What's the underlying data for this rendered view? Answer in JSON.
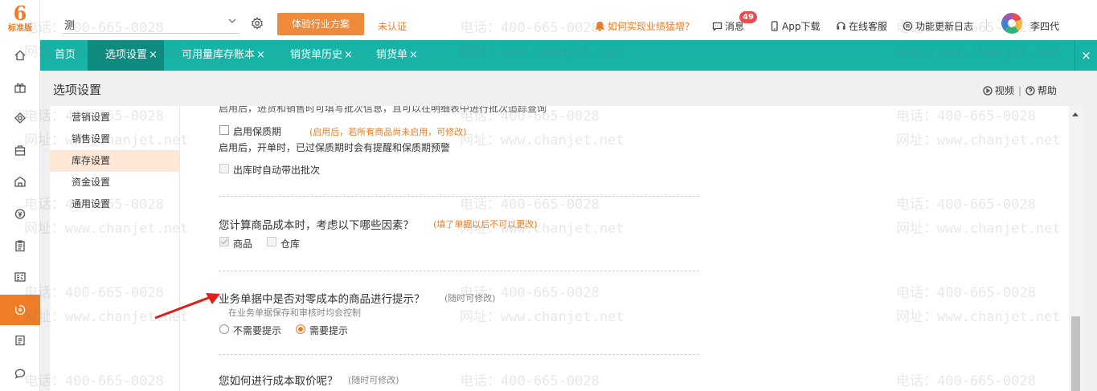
{
  "app": {
    "logo_glyph": "6",
    "logo_edition": "标准版"
  },
  "rail": {
    "items": [
      {
        "icon": "home-icon"
      },
      {
        "icon": "gift-icon"
      },
      {
        "icon": "marketing-icon"
      },
      {
        "icon": "bag-icon"
      },
      {
        "icon": "warehouse-icon"
      },
      {
        "icon": "money-icon"
      },
      {
        "icon": "clipboard-icon"
      },
      {
        "icon": "report-icon"
      },
      {
        "icon": "settings-cycle-icon",
        "active": true
      },
      {
        "icon": "doc-icon"
      },
      {
        "icon": "chat-icon"
      }
    ]
  },
  "topbar": {
    "account_value": "测",
    "experience_button": "体验行业方案",
    "unverified": "未认证",
    "promo_link": "如何实现业绩猛增?",
    "messages_label": "消息",
    "messages_badge": "49",
    "app_download": "App下载",
    "online_service": "在线客服",
    "changelog": "功能更新日志",
    "username": "李四代"
  },
  "tabs": [
    {
      "label": "首页",
      "closable": false
    },
    {
      "label": "选项设置",
      "closable": true,
      "active": true
    },
    {
      "label": "可用量库存账本",
      "closable": true
    },
    {
      "label": "销货单历史",
      "closable": true
    },
    {
      "label": "销货单",
      "closable": true
    }
  ],
  "tab_close_glyph": "×",
  "page": {
    "title": "选项设置",
    "video_label": "视频",
    "help_label": "帮助",
    "separator": "|"
  },
  "nav": {
    "items": [
      {
        "label": "营销设置"
      },
      {
        "label": "销售设置"
      },
      {
        "label": "库存设置",
        "active": true
      },
      {
        "label": "资金设置"
      },
      {
        "label": "通用设置"
      }
    ]
  },
  "settings": {
    "cut_line": "启用后，进货和销售时可填写批次信息，且可以在明细表中进行批次追踪查询",
    "shelf_life_label": "启用保质期",
    "shelf_life_note": "(启用后，若所有商品尚未启用，可修改)",
    "shelf_life_desc": "启用后，开单时，已过保质期时会有提醒和保质期预警",
    "auto_batch_label": "出库时自动带出批次",
    "cost_factor_q": "您计算商品成本时，考虑以下哪些因素？",
    "cost_factor_note": "(填了单据以后不可以更改)",
    "factor_product": "商品",
    "factor_warehouse": "仓库",
    "zero_cost_q": "业务单据中是否对零成本的商品进行提示？",
    "zero_cost_note": "(随时可修改)",
    "zero_cost_desc": "在业务单据保存和审核时均会控制",
    "opt_no": "不需要提示",
    "opt_yes": "需要提示",
    "cost_price_q": "您如何进行成本取价呢？",
    "cost_price_note": "(随时可修改)"
  },
  "watermark": {
    "phone": "电话：400-665-0028",
    "site": "网址：www.chanjet.net"
  }
}
